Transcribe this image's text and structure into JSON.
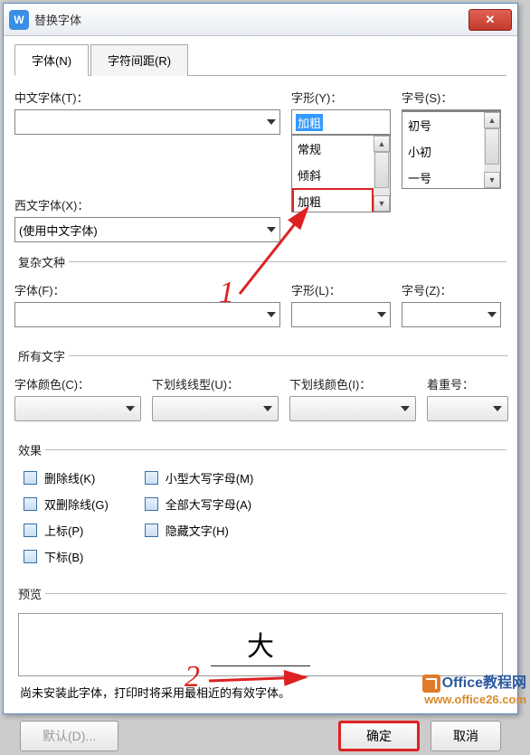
{
  "window": {
    "title": "替换字体"
  },
  "tabs": {
    "font": "字体(N)",
    "spacing": "字符间距(R)"
  },
  "labels": {
    "cn_font": "中文字体(T)：",
    "style": "字形(Y)：",
    "size": "字号(S)：",
    "west_font": "西文字体(X)：",
    "complex": "复杂文种",
    "c_font": "字体(F)：",
    "c_style": "字形(L)：",
    "c_size": "字号(Z)：",
    "all_text": "所有文字",
    "font_color": "字体颜色(C)：",
    "underline_style": "下划线线型(U)：",
    "underline_color": "下划线颜色(I)：",
    "emphasis": "着重号：",
    "effects": "效果",
    "preview": "预览"
  },
  "values": {
    "style_input": "加粗",
    "west_font": "(使用中文字体)",
    "preview_text": "大"
  },
  "style_list": [
    "常规",
    "倾斜",
    "加粗"
  ],
  "size_list": [
    "初号",
    "小初",
    "一号"
  ],
  "effects": {
    "strike": "删除线(K)",
    "dstrike": "双删除线(G)",
    "sup": "上标(P)",
    "sub": "下标(B)",
    "smallcaps": "小型大写字母(M)",
    "allcaps": "全部大写字母(A)",
    "hidden": "隐藏文字(H)"
  },
  "note": "尚未安装此字体，打印时将采用最相近的有效字体。",
  "buttons": {
    "default": "默认(D)...",
    "ok": "确定",
    "cancel": "取消"
  },
  "annotations": {
    "a1": "1",
    "a2": "2"
  },
  "watermark": {
    "line1": "Office教程网",
    "line2": "www.office26.com"
  }
}
